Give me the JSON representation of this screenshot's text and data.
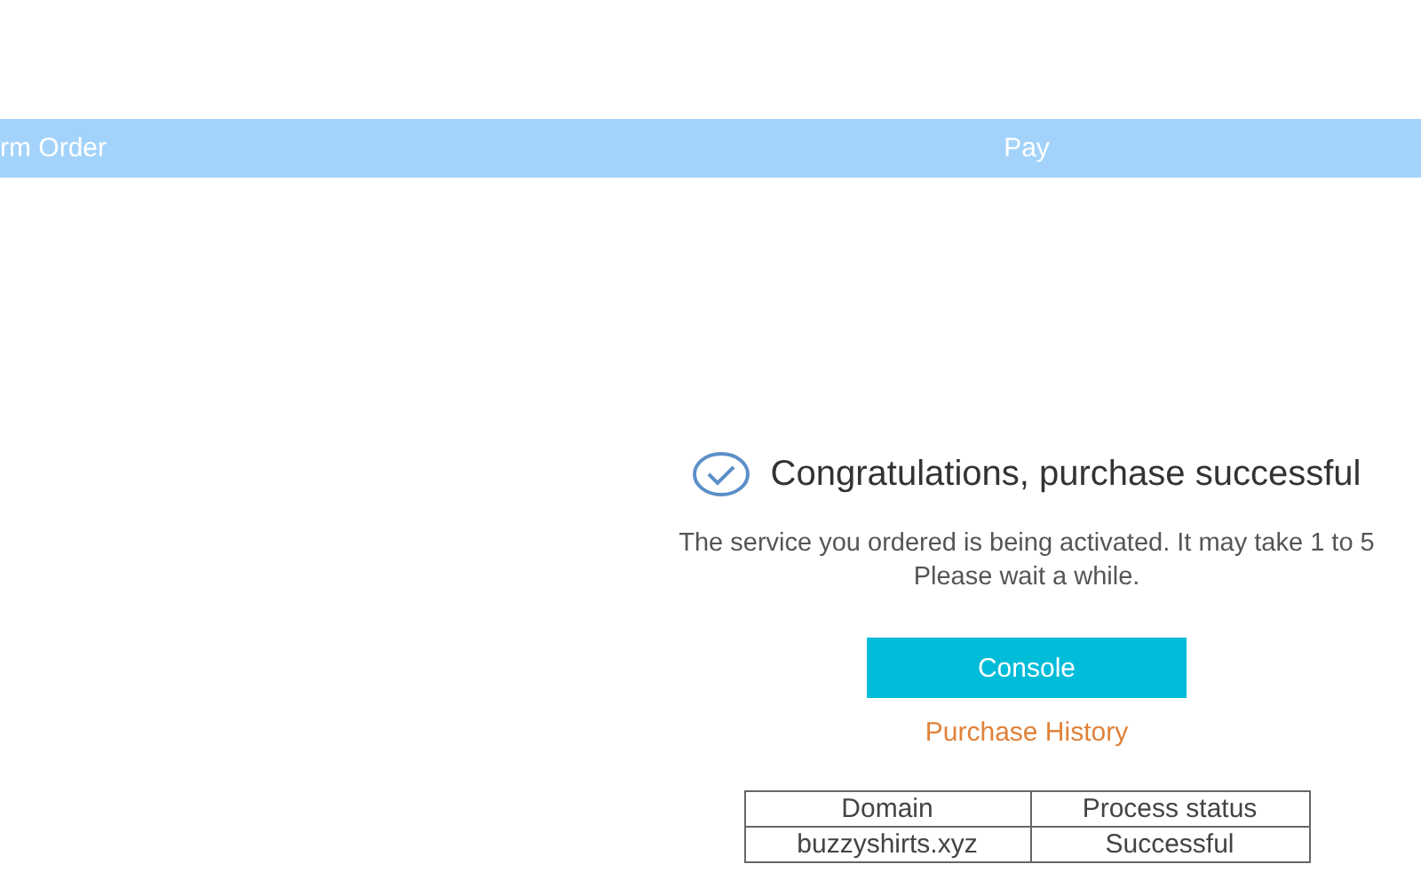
{
  "steps": [
    {
      "label": "rm Order"
    },
    {
      "label": "Pay"
    }
  ],
  "result": {
    "title": "Congratulations, purchase successful",
    "message": "The service you ordered is being activated. It may take 1 to 5",
    "note": "Please wait a while."
  },
  "buttons": {
    "console": "Console",
    "history": "Purchase History"
  },
  "table": {
    "columns": [
      "Domain",
      "Process status"
    ],
    "rows": [
      [
        "buzzyshirts.xyz",
        "Successful"
      ]
    ]
  }
}
